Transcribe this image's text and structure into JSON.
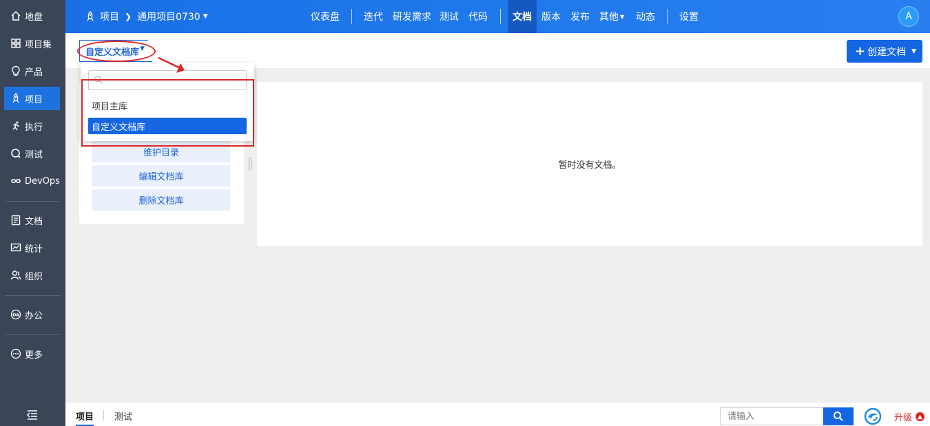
{
  "sidebar": {
    "items": [
      {
        "label": "地盘",
        "icon": "home-icon"
      },
      {
        "label": "项目集",
        "icon": "grid-icon"
      },
      {
        "label": "产品",
        "icon": "lightbulb-icon"
      },
      {
        "label": "项目",
        "icon": "rocket-icon"
      },
      {
        "label": "执行",
        "icon": "runner-icon"
      },
      {
        "label": "测试",
        "icon": "magnifier-icon"
      },
      {
        "label": "DevOps",
        "icon": "infinity-icon"
      },
      {
        "label": "文档",
        "icon": "document-icon"
      },
      {
        "label": "统计",
        "icon": "chart-icon"
      },
      {
        "label": "组织",
        "icon": "people-icon"
      },
      {
        "label": "办公",
        "icon": "oa-icon"
      },
      {
        "label": "更多",
        "icon": "more-icon"
      }
    ],
    "active_index": 3
  },
  "topbar": {
    "crumb_root": "项目",
    "crumb_project": "通用项目0730",
    "nav": [
      "仪表盘",
      "迭代",
      "研发需求",
      "测试",
      "代码",
      "文档",
      "版本",
      "发布",
      "其他",
      "动态",
      "设置"
    ],
    "active_nav": "文档",
    "avatar": "A",
    "accent": "#1a6fe6"
  },
  "subheader": {
    "library_selector": "自定义文档库",
    "create_button": "创建文档"
  },
  "dropdown": {
    "search_value": "",
    "options": [
      "项目主库",
      "自定义文档库"
    ],
    "selected": "自定义文档库"
  },
  "left_panel": {
    "buttons": [
      "维护目录",
      "编辑文档库",
      "删除文档库"
    ]
  },
  "main": {
    "empty_text": "暂时没有文档。"
  },
  "bottombar": {
    "tabs": [
      "项目",
      "测试"
    ],
    "active_tab": "项目",
    "search_placeholder": "请输入",
    "upgrade": "升级"
  }
}
